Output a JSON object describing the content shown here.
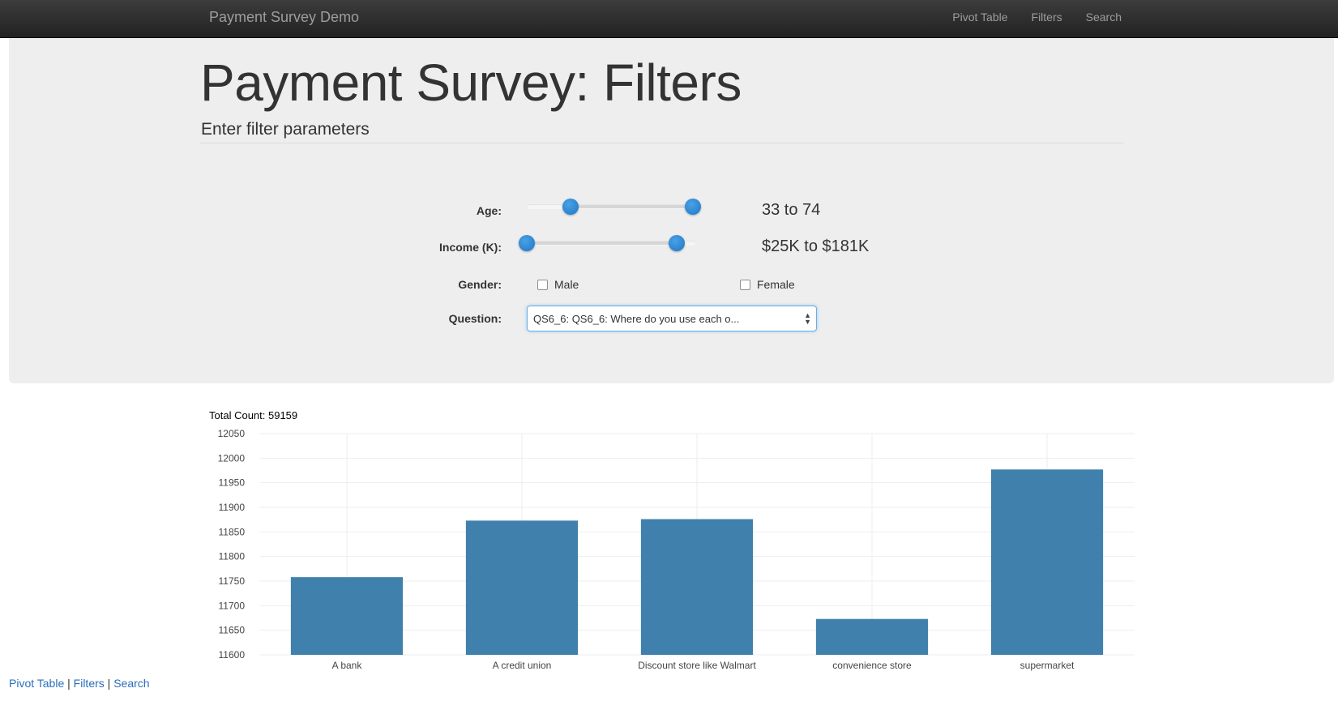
{
  "navbar": {
    "brand": "Payment Survey Demo",
    "links": [
      "Pivot Table",
      "Filters",
      "Search"
    ]
  },
  "header": {
    "title": "Payment Survey: Filters",
    "subtitle": "Enter filter parameters"
  },
  "filters": {
    "age": {
      "label": "Age:",
      "range_text": "33 to 74",
      "low_fraction": 0.25,
      "high_fraction": 0.96
    },
    "income": {
      "label": "Income (K):",
      "range_text": "$25K to $181K",
      "low_fraction": 0.0,
      "high_fraction": 0.89
    },
    "gender": {
      "label": "Gender:",
      "options": [
        "Male",
        "Female"
      ],
      "checked": [
        false,
        false
      ]
    },
    "question": {
      "label": "Question:",
      "selected": "QS6_6: QS6_6: Where do you use each o..."
    }
  },
  "colors": {
    "bar": "#4080ac",
    "slider_handle": "#2a84d2",
    "jumbotron_bg": "#eeeeee",
    "navbar_bg": "#222222",
    "link": "#2a6ebb"
  },
  "total_count": "Total Count: 59159",
  "chart_data": {
    "type": "bar",
    "categories": [
      "A bank",
      "A credit union",
      "Discount store like Walmart",
      "convenience store",
      "supermarket"
    ],
    "values": [
      11758,
      11873,
      11876,
      11673,
      11977
    ],
    "ylim": [
      11600,
      12050
    ],
    "yticks": [
      11600,
      11650,
      11700,
      11750,
      11800,
      11850,
      11900,
      11950,
      12000,
      12050
    ],
    "grid": true
  },
  "footer": {
    "links": [
      "Pivot Table",
      "Filters",
      "Search"
    ],
    "separator": "|"
  }
}
